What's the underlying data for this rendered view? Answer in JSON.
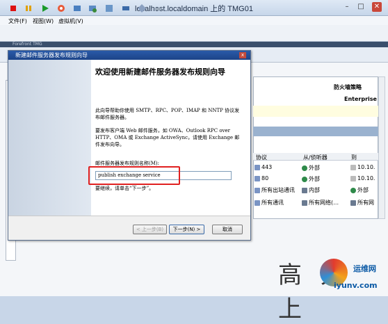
{
  "window": {
    "title": "localhost.localdomain 上的 TMG01",
    "min": "–",
    "max": "□",
    "close": "✕"
  },
  "menu": [
    {
      "label": "文件(F)"
    },
    {
      "label": "视图(W)"
    },
    {
      "label": "虚拟机(V)"
    }
  ],
  "guest": {
    "title": "Forefront TMG"
  },
  "right_panel": {
    "title": "防火墙策略",
    "edition": "Enterprise",
    "columns": [
      "协议",
      "从/侦听器",
      "到"
    ],
    "rows": [
      {
        "protocol": "443",
        "from": "外部",
        "to": "10.10."
      },
      {
        "protocol": "80",
        "from": "外部",
        "to": "10.10."
      },
      {
        "protocol": "所有出站通讯",
        "from": "内部",
        "to": "外部"
      },
      {
        "protocol": "所有通讯",
        "from": "所有网络(…",
        "to": "所有网"
      }
    ]
  },
  "dialog": {
    "title": "新建邮件服务器发布规则向导",
    "close": "x",
    "welcome": "欢迎使用新建邮件服务器发布规则向导",
    "para1": "此向导帮助你使用 SMTP、RPC、POP、IMAP 和 NNTP 协议发布邮件服务器。",
    "para2": "要发布客户端 Web 邮件服务，如 OWA、Outlook RPC over HTTP、OMA 或 Exchange ActiveSync，请使用 Exchange 邮件发布向导。",
    "name_label": "邮件服务器发布规则名称(M):",
    "name_value": "publish exchange service",
    "continue": "要继续，请单击“下一步”。",
    "back_button": "< 上一步(B)",
    "next_button": "下一步(N) >",
    "cancel_button": "取消"
  },
  "watermark": {
    "text": "高 大 上",
    "brand": "运维网",
    "url": "iyunv.com"
  }
}
